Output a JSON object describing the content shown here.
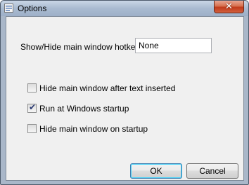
{
  "window": {
    "title": "Options",
    "close_glyph": "✕"
  },
  "hotkey": {
    "label": "Show/Hide main window hotkey:",
    "value": "None"
  },
  "options": [
    {
      "label": "Hide main window after text inserted",
      "checked": false
    },
    {
      "label": "Run at Windows startup",
      "checked": true
    },
    {
      "label": "Hide main window on startup",
      "checked": false
    }
  ],
  "check_glyph": "✔",
  "buttons": {
    "ok": "OK",
    "cancel": "Cancel"
  },
  "colors": {
    "accent": "#3c7fb1",
    "close": "#c13a1a"
  }
}
